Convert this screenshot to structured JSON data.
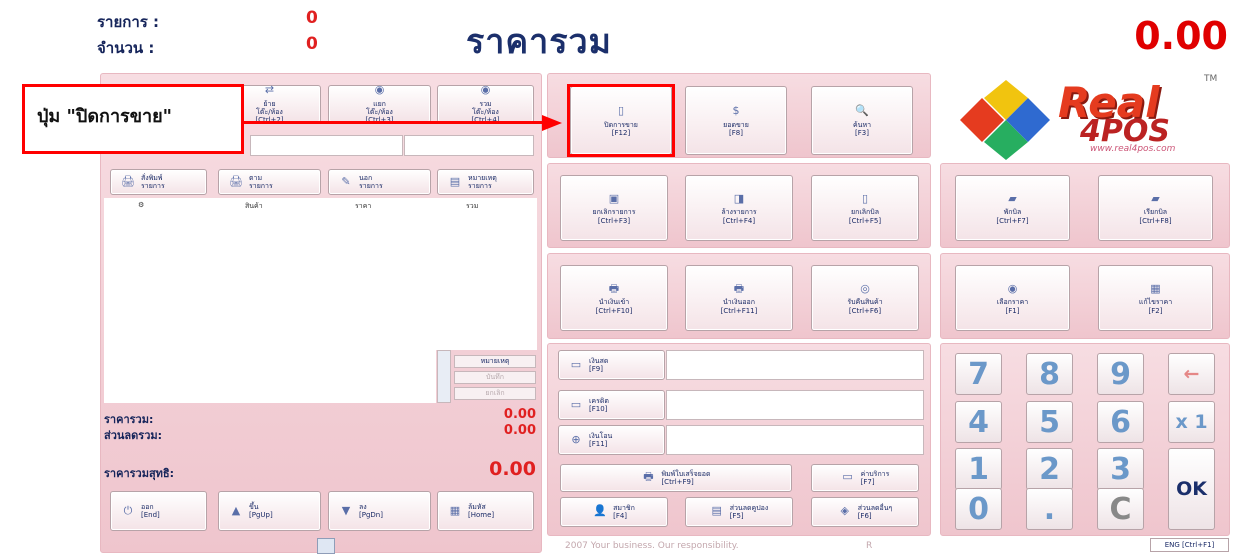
{
  "header": {
    "items_label": "รายการ :",
    "items_value": "0",
    "qty_label": "จำนวน :",
    "qty_value": "0",
    "title": "ราคารวม",
    "total": "0.00"
  },
  "annotation": {
    "text": "ปุ่ม \"ปิดการขาย\""
  },
  "left_top_buttons": [
    {
      "label": "ย้าย\nโต๊ะ/ห้อง\n[Ctrl+2]",
      "icon": "move-table-icon"
    },
    {
      "label": "แยก\nโต๊ะ/ห้อง\n[Ctrl+3]",
      "icon": "split-table-icon"
    },
    {
      "label": "รวม\nโต๊ะ/ห้อง\n[Ctrl+4]",
      "icon": "merge-table-icon"
    }
  ],
  "left_mid_buttons": [
    {
      "label": "สั่งพิมพ์\nรายการ",
      "icon": "print-order-icon"
    },
    {
      "label": "ตาม\nรายการ",
      "icon": "follow-order-icon"
    },
    {
      "label": "นอก\nรายการ",
      "icon": "outside-order-icon"
    },
    {
      "label": "หมายเหตุ\nรายการ",
      "icon": "note-order-icon"
    }
  ],
  "table": {
    "columns": [
      "",
      "สินค้า",
      "ราคา",
      "รวม"
    ]
  },
  "side_buttons": {
    "note": "หมายเหตุ",
    "save": "บันทึก",
    "cancel": "ยกเลิก"
  },
  "summary": {
    "subtotal_label": "ราคารวม:",
    "subtotal_value": "0.00",
    "discount_label": "ส่วนลดรวม:",
    "discount_value": "0.00",
    "net_label": "ราคารวมสุทธิ:",
    "net_value": "0.00"
  },
  "bottom_buttons": [
    {
      "label": "ออก\n[End]",
      "icon": "exit-icon"
    },
    {
      "label": "ขึ้น\n[PgUp]",
      "icon": "arrow-up-icon"
    },
    {
      "label": "ลง\n[PgDn]",
      "icon": "arrow-down-icon"
    },
    {
      "label": "ล้มหัส\n[Home]",
      "icon": "home-icon"
    }
  ],
  "function_buttons_row1": [
    {
      "label": "ปิดการขาย\n[F12]",
      "icon": "close-sale-icon"
    },
    {
      "label": "ยอดขาย\n[F8]",
      "icon": "sales-total-icon"
    },
    {
      "label": "ค้นหา\n[F3]",
      "icon": "search-icon"
    }
  ],
  "function_buttons_row2": [
    {
      "label": "ยกเลิกรายการ\n[Ctrl+F3]",
      "icon": "cancel-item-icon"
    },
    {
      "label": "ล้างรายการ\n[Ctrl+F4]",
      "icon": "clear-items-icon"
    },
    {
      "label": "ยกเลิกบิล\n[Ctrl+F5]",
      "icon": "cancel-bill-icon"
    }
  ],
  "function_buttons_row3": [
    {
      "label": "นำเงินเข้า\n[Ctrl+F10]",
      "icon": "cash-in-icon"
    },
    {
      "label": "นำเงินออก\n[Ctrl+F11]",
      "icon": "cash-out-icon"
    },
    {
      "label": "รับคืนสินค้า\n[Ctrl+F6]",
      "icon": "return-goods-icon"
    }
  ],
  "hold_buttons": [
    {
      "label": "พักบิล\n[Ctrl+F7]",
      "icon": "hold-bill-icon"
    },
    {
      "label": "เรียกบิล\n[Ctrl+F8]",
      "icon": "recall-bill-icon"
    }
  ],
  "price_buttons": [
    {
      "label": "เลือกราคา\n[F1]",
      "icon": "select-price-icon"
    },
    {
      "label": "แก้ไขราคา\n[F2]",
      "icon": "edit-price-icon"
    }
  ],
  "payment_buttons": [
    {
      "label": "เงินสด\n[F9]",
      "icon": "cash-icon"
    },
    {
      "label": "เครดิต\n[F10]",
      "icon": "credit-card-icon"
    },
    {
      "label": "เงินโอน\n[F11]",
      "icon": "transfer-icon"
    }
  ],
  "misc_buttons": {
    "print_receipt": "พิมพ์ใบเสร็จยอด\n[Ctrl+F9]",
    "service": "ค่าบริการ\n[F7]",
    "member": "สมาชิก\n[F4]",
    "coupon": "ส่วนลดคูปอง\n[F5]",
    "other_discount": "ส่วนลดอื่นๆ\n[F6]"
  },
  "keypad": {
    "keys": [
      "7",
      "8",
      "9",
      "←",
      "4",
      "5",
      "6",
      "x 1",
      "1",
      "2",
      "3",
      "0",
      ".",
      "C"
    ],
    "ok": "OK"
  },
  "logo": {
    "word": "Real",
    "sub": "4POS",
    "url": "www.real4pos.com",
    "tm": "TM"
  },
  "footer": {
    "slogan": "2007 Your business. Our responsibility.",
    "mark": "R",
    "lang": "ENG [Ctrl+F1]"
  },
  "colors": {
    "accent_red": "#e00000",
    "panel_pink": "#f2cfd6",
    "title_navy": "#1b2f6b",
    "key_blue": "#6b98c9"
  }
}
